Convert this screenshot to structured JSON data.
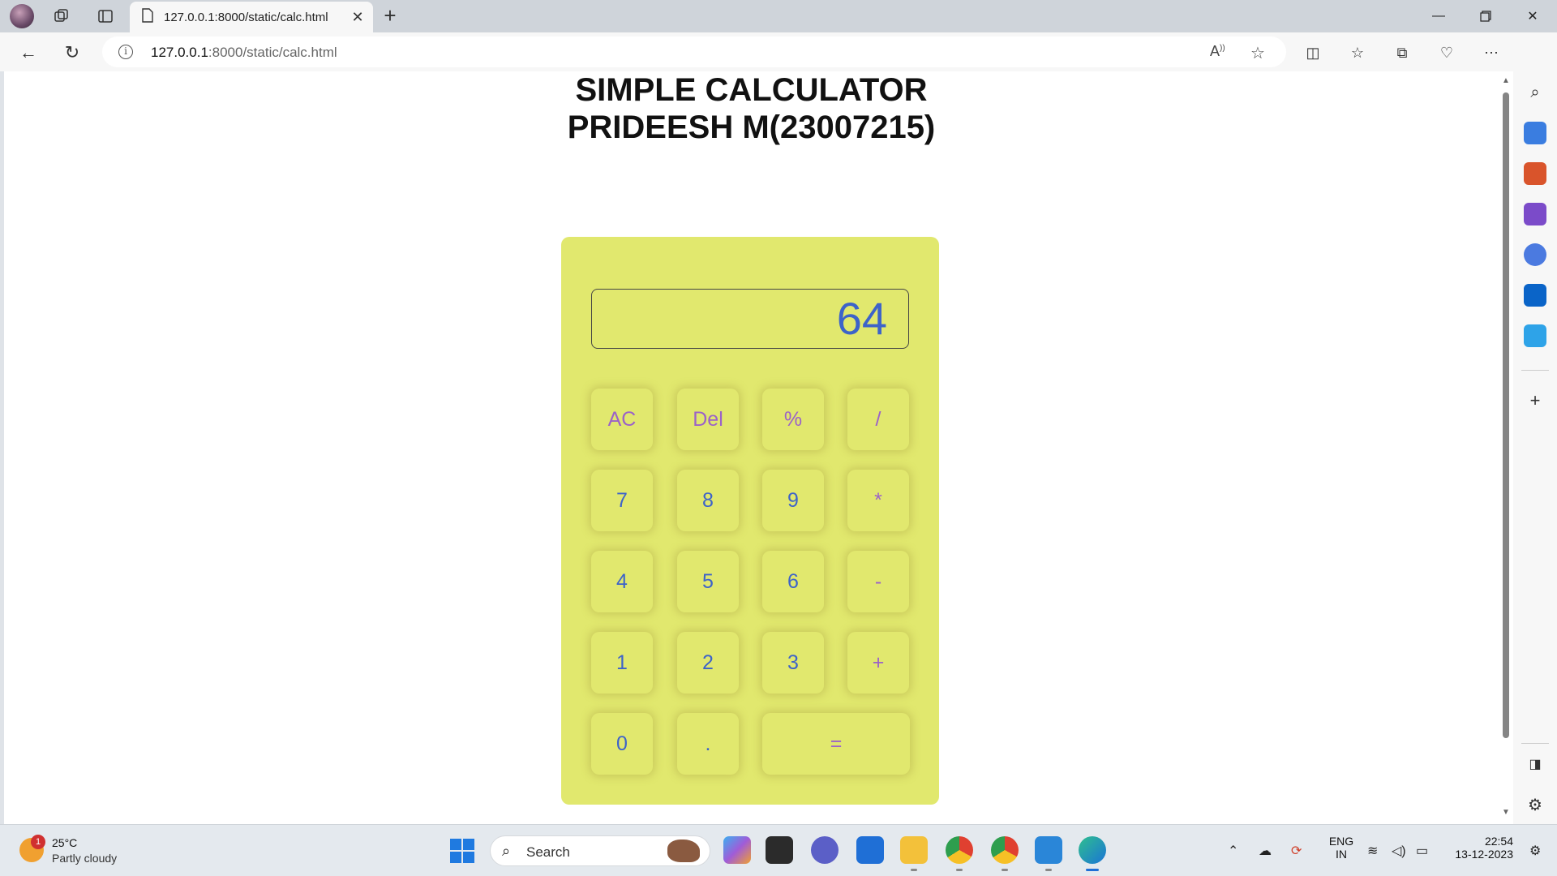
{
  "browser": {
    "tab_title": "127.0.0.1:8000/static/calc.html",
    "url_host": "127.0.0.1",
    "url_path": ":8000/static/calc.html"
  },
  "page": {
    "title_line1": "SIMPLE CALCULATOR",
    "title_line2": "PRIDEESH M(23007215)"
  },
  "calculator": {
    "display": "64",
    "keys": {
      "ac": "AC",
      "del": "Del",
      "percent": "%",
      "divide": "/",
      "seven": "7",
      "eight": "8",
      "nine": "9",
      "multiply": "*",
      "four": "4",
      "five": "5",
      "six": "6",
      "minus": "-",
      "one": "1",
      "two": "2",
      "three": "3",
      "plus": "+",
      "zero": "0",
      "dot": ".",
      "equals": "="
    }
  },
  "taskbar": {
    "weather_badge": "1",
    "weather_temp": "25°C",
    "weather_desc": "Partly cloudy",
    "search_placeholder": "Search",
    "language_line1": "ENG",
    "language_line2": "IN",
    "time": "22:54",
    "date": "13-12-2023"
  },
  "colors": {
    "calculator_bg": "#e1e86e",
    "number_key": "#3d63c9",
    "function_key": "#9b62c8"
  }
}
